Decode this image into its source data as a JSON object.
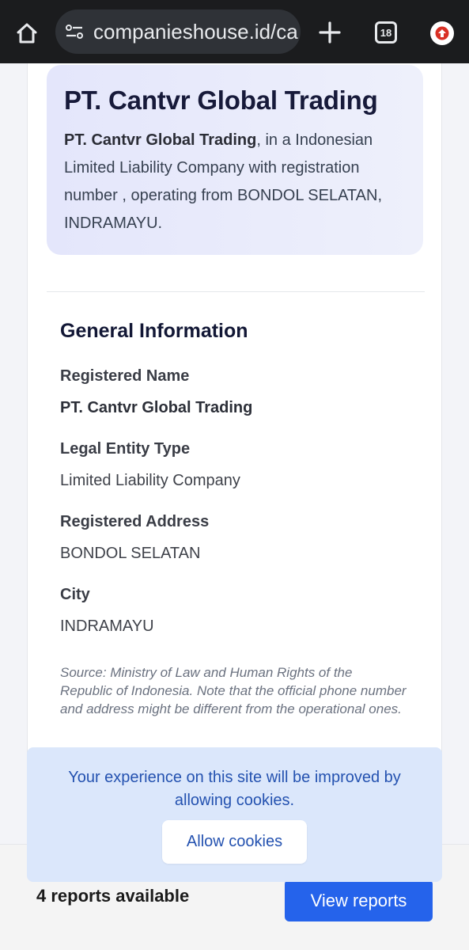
{
  "browser": {
    "url": "companieshouse.id/ca",
    "tab_count": "18",
    "icons": [
      "home-icon",
      "site-settings-icon",
      "new-tab-icon",
      "tab-switcher-icon",
      "update-icon"
    ]
  },
  "hero": {
    "title": "PT. Cantvr Global Trading",
    "desc_strong": "PT. Cantvr Global Trading",
    "desc_rest": ", in a Indonesian Limited Liability Company with registration number , operating from BONDOL SELATAN, INDRAMAYU."
  },
  "general": {
    "heading": "General Information",
    "fields": [
      {
        "label": "Registered Name",
        "value": "PT. Cantvr Global Trading"
      },
      {
        "label": "Legal Entity Type",
        "value": "Limited Liability Company"
      },
      {
        "label": "Registered Address",
        "value": "BONDOL SELATAN"
      },
      {
        "label": "City",
        "value": "INDRAMAYU"
      }
    ],
    "source": "Source: Ministry of Law and Human Rights of the Republic of Indonesia. Note that the official phone number and address might be different from the operational ones."
  },
  "cookie": {
    "message": "Your experience on this site will be improved by allowing cookies.",
    "button": "Allow cookies"
  },
  "reports": {
    "count_text": "4 reports available",
    "button": "View reports"
  },
  "colors": {
    "accent": "#2563eb",
    "cookie_bg": "#dbe7fb",
    "cookie_text": "#2452b0",
    "chrome_bg": "#1b1c1e"
  }
}
